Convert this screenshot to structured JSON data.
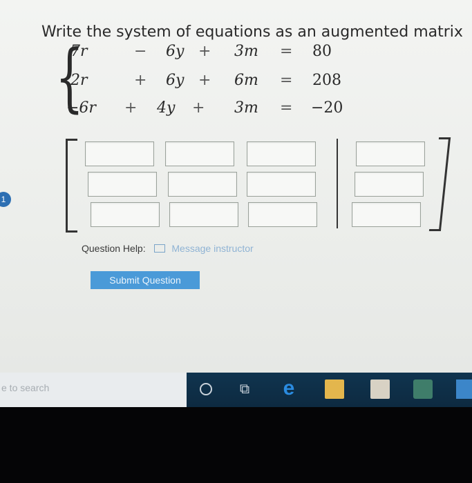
{
  "question": {
    "title": "Write the system of equations as an augmented matrix",
    "number_badge": "1",
    "equations": [
      {
        "x": "7r",
        "op1": "−",
        "y": "6y",
        "op2": "+",
        "z": "3m",
        "eq": "=",
        "rhs": "80"
      },
      {
        "x": "2r",
        "op1": "+",
        "y": "6y",
        "op2": "+",
        "z": "6m",
        "eq": "=",
        "rhs": "208"
      },
      {
        "x": "−6r",
        "op1": "+",
        "y": "4y",
        "op2": "+",
        "z": "3m",
        "eq": "=",
        "rhs": "−20"
      }
    ],
    "matrix": {
      "rows": 3,
      "coefficient_columns": 3,
      "constant_columns": 1,
      "cells": [
        [
          "",
          "",
          "",
          ""
        ],
        [
          "",
          "",
          "",
          ""
        ],
        [
          "",
          "",
          "",
          ""
        ]
      ]
    }
  },
  "help": {
    "label": "Question Help:",
    "message_link": "Message instructor",
    "icon": "mail-icon"
  },
  "submit": {
    "label": "Submit Question",
    "color": "#4a9ad8"
  },
  "taskbar": {
    "search_placeholder": "e to search",
    "icons": [
      "cortana-icon",
      "task-view-icon",
      "edge-icon",
      "file-explorer-icon",
      "store-icon",
      "app-icon",
      "app-icon"
    ]
  }
}
